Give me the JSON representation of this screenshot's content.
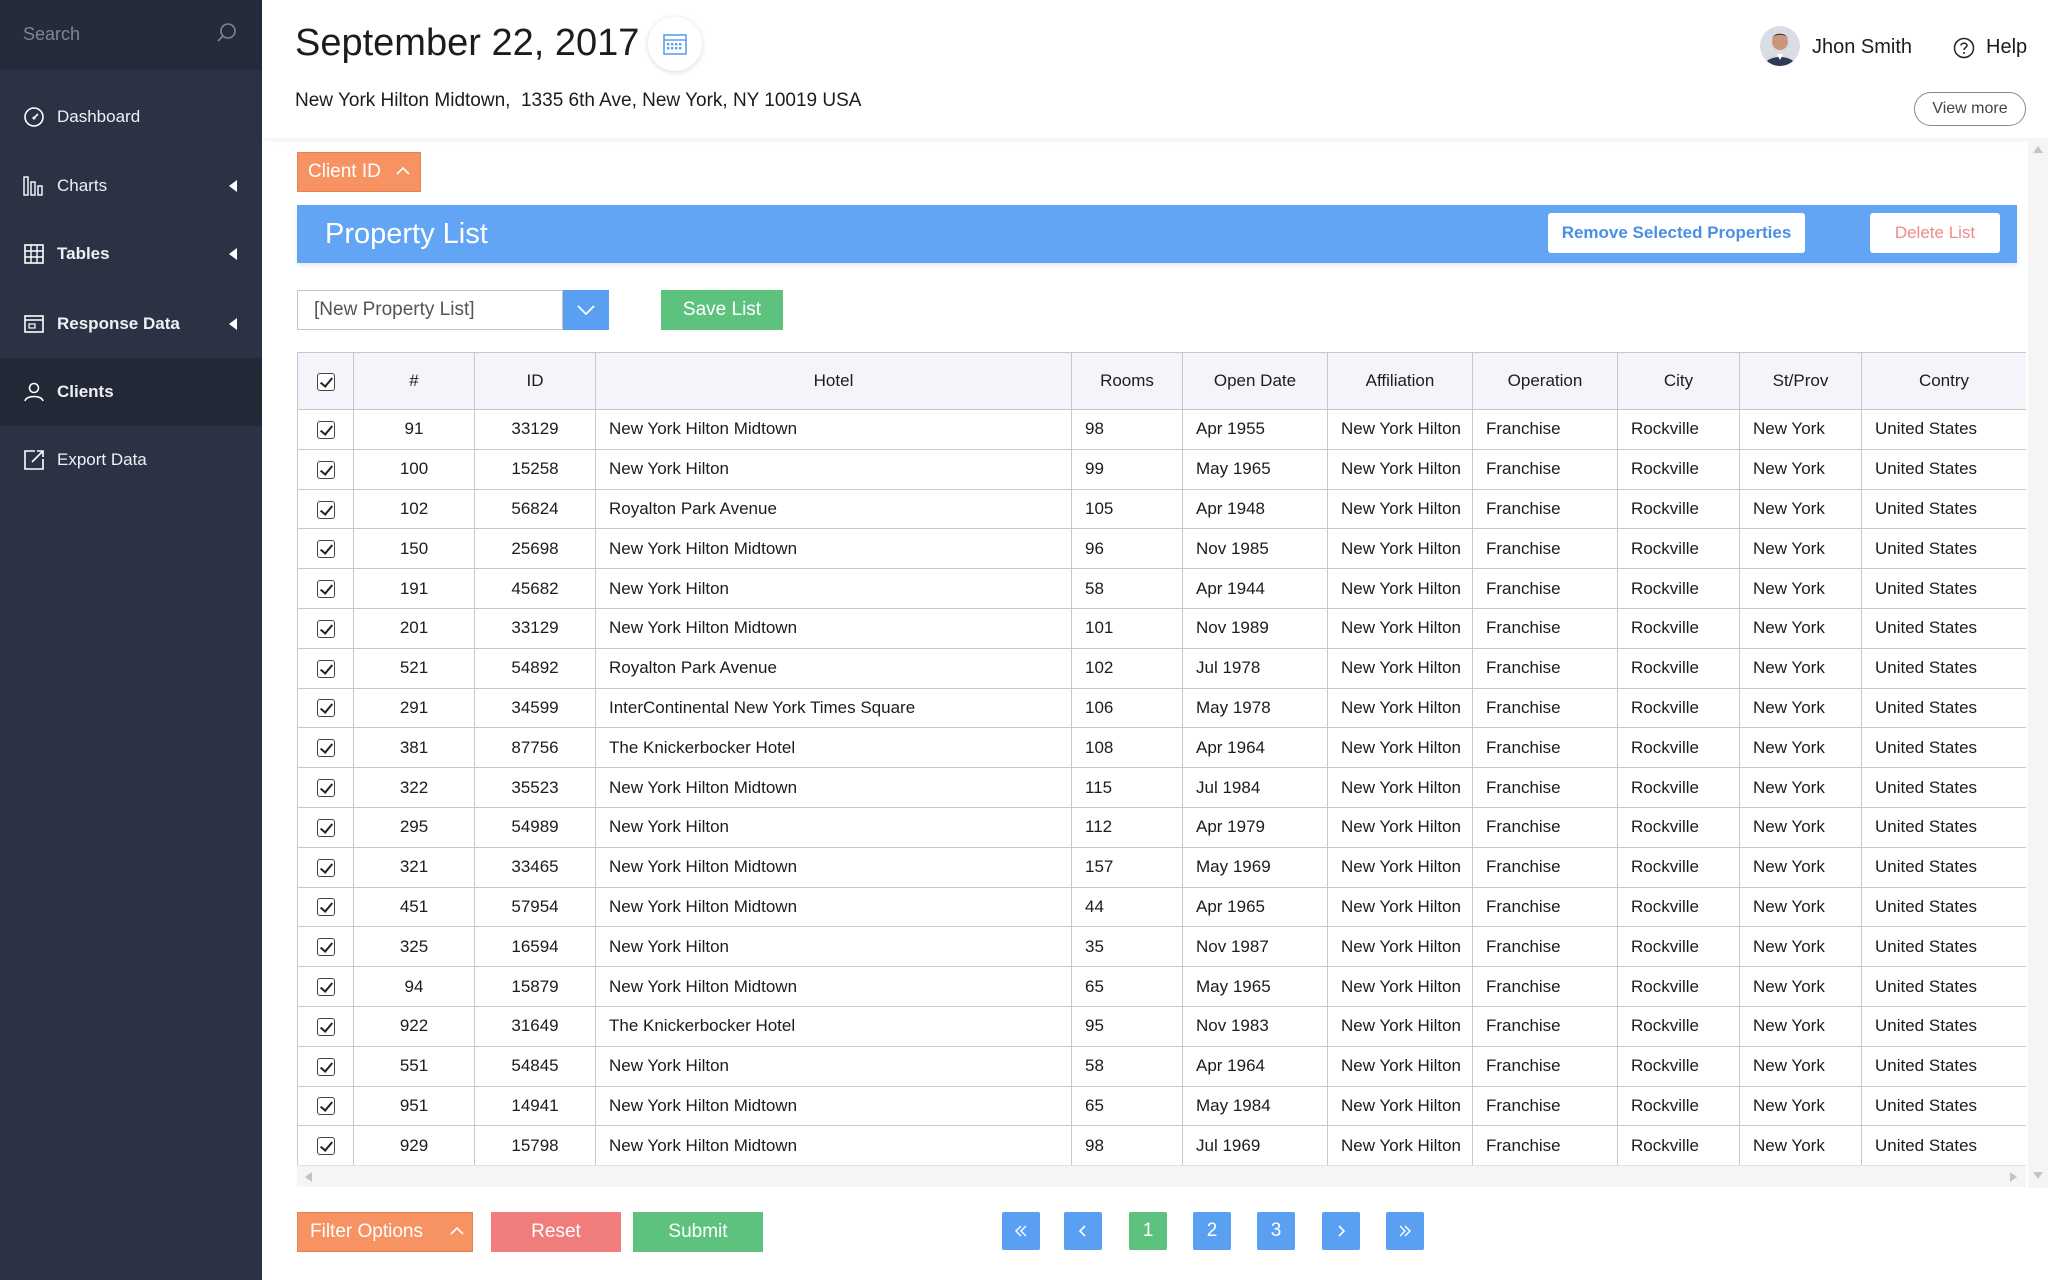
{
  "sidebar": {
    "search_placeholder": "Search",
    "items": [
      {
        "label": "Dashboard",
        "icon": "dashboard-icon"
      },
      {
        "label": "Charts",
        "icon": "bar-chart-icon"
      },
      {
        "label": "Tables",
        "icon": "table-icon"
      },
      {
        "label": "Response Data",
        "icon": "browser-window-icon"
      },
      {
        "label": "Clients",
        "icon": "user-icon"
      },
      {
        "label": "Export Data",
        "icon": "export-icon"
      }
    ]
  },
  "header": {
    "date": "September 22, 2017",
    "address": "New York Hilton Midtown,  1335 6th Ave, New York, NY 10019 USA",
    "user_name": "Jhon Smith",
    "help_label": "Help",
    "view_more_label": "View more"
  },
  "client_id_label": "Client ID",
  "property_list": {
    "title": "Property List",
    "remove_label": "Remove Selected Properties",
    "delete_label": "Delete List",
    "select_value": "[New Property List]",
    "save_label": "Save List"
  },
  "table": {
    "columns": [
      "#",
      "ID",
      "Hotel",
      "Rooms",
      "Open Date",
      "Affiliation",
      "Operation",
      "City",
      "St/Prov",
      "Contry"
    ],
    "rows": [
      [
        "91",
        "33129",
        "New York Hilton Midtown",
        "98",
        "Apr 1955",
        "New York Hilton",
        "Franchise",
        "Rockville",
        "New York",
        "United States"
      ],
      [
        "100",
        "15258",
        "New York Hilton",
        "99",
        "May 1965",
        "New York Hilton",
        "Franchise",
        "Rockville",
        "New York",
        "United States"
      ],
      [
        "102",
        "56824",
        "Royalton Park Avenue",
        "105",
        "Apr 1948",
        "New York Hilton",
        "Franchise",
        "Rockville",
        "New York",
        "United States"
      ],
      [
        "150",
        "25698",
        "New York Hilton Midtown",
        "96",
        "Nov 1985",
        "New York Hilton",
        "Franchise",
        "Rockville",
        "New York",
        "United States"
      ],
      [
        "191",
        "45682",
        "New York Hilton",
        "58",
        "Apr 1944",
        "New York Hilton",
        "Franchise",
        "Rockville",
        "New York",
        "United States"
      ],
      [
        "201",
        "33129",
        "New York Hilton Midtown",
        "101",
        "Nov 1989",
        "New York Hilton",
        "Franchise",
        "Rockville",
        "New York",
        "United States"
      ],
      [
        "521",
        "54892",
        "Royalton Park Avenue",
        "102",
        "Jul 1978",
        "New York Hilton",
        "Franchise",
        "Rockville",
        "New York",
        "United States"
      ],
      [
        "291",
        "34599",
        "InterContinental New York Times Square",
        "106",
        "May 1978",
        "New York Hilton",
        "Franchise",
        "Rockville",
        "New York",
        "United States"
      ],
      [
        "381",
        "87756",
        "The Knickerbocker Hotel",
        "108",
        "Apr 1964",
        "New York Hilton",
        "Franchise",
        "Rockville",
        "New York",
        "United States"
      ],
      [
        "322",
        "35523",
        "New York Hilton Midtown",
        "115",
        "Jul  1984",
        "New York Hilton",
        "Franchise",
        "Rockville",
        "New York",
        "United States"
      ],
      [
        "295",
        "54989",
        "New York Hilton",
        "112",
        "Apr 1979",
        "New York Hilton",
        "Franchise",
        "Rockville",
        "New York",
        "United States"
      ],
      [
        "321",
        "33465",
        "New York Hilton Midtown",
        "157",
        "May 1969",
        "New York Hilton",
        "Franchise",
        "Rockville",
        "New York",
        "United States"
      ],
      [
        "451",
        "57954",
        "New York Hilton Midtown",
        "44",
        "Apr 1965",
        "New York Hilton",
        "Franchise",
        "Rockville",
        "New York",
        "United States"
      ],
      [
        "325",
        "16594",
        "New York Hilton",
        "35",
        "Nov 1987",
        "New York Hilton",
        "Franchise",
        "Rockville",
        "New York",
        "United States"
      ],
      [
        "94",
        "15879",
        "New York Hilton Midtown",
        "65",
        "May 1965",
        "New York Hilton",
        "Franchise",
        "Rockville",
        "New York",
        "United States"
      ],
      [
        "922",
        "31649",
        "The Knickerbocker Hotel",
        "95",
        "Nov 1983",
        "New York Hilton",
        "Franchise",
        "Rockville",
        "New York",
        "United States"
      ],
      [
        "551",
        "54845",
        "New York Hilton",
        "58",
        "Apr 1964",
        "New York Hilton",
        "Franchise",
        "Rockville",
        "New York",
        "United States"
      ],
      [
        "951",
        "14941",
        "New York Hilton Midtown",
        "65",
        "May 1984",
        "New York Hilton",
        "Franchise",
        "Rockville",
        "New York",
        "United States"
      ],
      [
        "929",
        "15798",
        "New York Hilton Midtown",
        "98",
        "Jul 1969",
        "New York Hilton",
        "Franchise",
        "Rockville",
        "New York",
        "United States"
      ]
    ]
  },
  "footer": {
    "filter_label": "Filter Options",
    "reset_label": "Reset",
    "submit_label": "Submit",
    "pages": [
      "1",
      "2",
      "3"
    ],
    "current_page": "1"
  },
  "colors": {
    "sidebar_bg": "#2b3244",
    "accent_blue": "#63a5f5",
    "accent_orange": "#f79363",
    "accent_green": "#5ec27f",
    "accent_red": "#f07c7c"
  }
}
